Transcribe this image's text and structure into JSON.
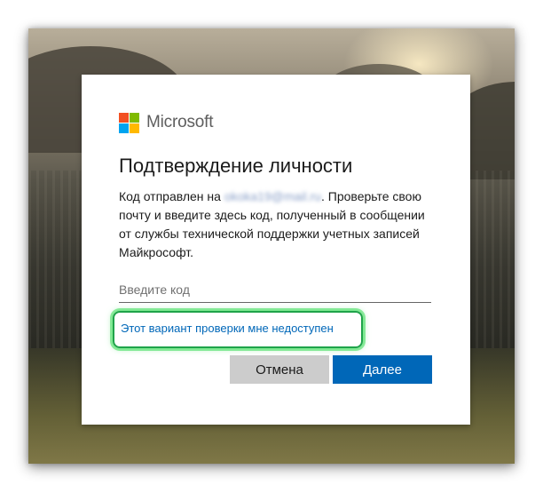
{
  "brand": {
    "name": "Microsoft",
    "logo_colors": [
      "#f25022",
      "#7fba00",
      "#00a4ef",
      "#ffb900"
    ]
  },
  "dialog": {
    "title": "Подтверждение личности",
    "description_prefix": "Код отправлен на ",
    "masked_email": "okoka19@mail.ru",
    "description_suffix": ". Проверьте свою почту и введите здесь код, полученный в сообщении от службы технической поддержки учетных записей Майкрософт."
  },
  "code_input": {
    "placeholder": "Введите код",
    "value": ""
  },
  "alt_option_link": "Этот вариант проверки мне недоступен",
  "buttons": {
    "cancel": "Отмена",
    "next": "Далее"
  },
  "colors": {
    "primary": "#0067b8",
    "highlight": "#1fa34a"
  }
}
